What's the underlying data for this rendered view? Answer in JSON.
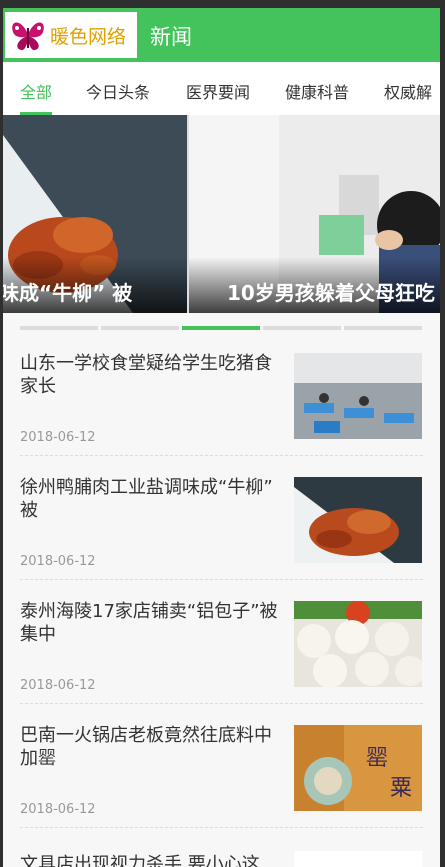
{
  "header": {
    "logo_text": "暖色网络",
    "title": "新闻"
  },
  "tabs": [
    {
      "label": "全部",
      "active": true
    },
    {
      "label": "今日头条",
      "active": false
    },
    {
      "label": "医界要闻",
      "active": false
    },
    {
      "label": "健康科普",
      "active": false
    },
    {
      "label": "权威解",
      "active": false
    }
  ],
  "carousel": {
    "slides": [
      {
        "caption": "味成“牛柳” 被"
      },
      {
        "caption": "10岁男孩躲着父母狂吃"
      }
    ],
    "indicator_count": 5,
    "active_index": 2
  },
  "news": [
    {
      "title": "山东一学校食堂疑给学生吃猪食家长",
      "date": "2018-06-12",
      "thumb": "cafeteria-photo"
    },
    {
      "title": "徐州鸭脯肉工业盐调味成“牛柳” 被",
      "date": "2018-06-12",
      "thumb": "braised-meat-photo"
    },
    {
      "title": "泰州海陵17家店铺卖“铝包子”被集中",
      "date": "2018-06-12",
      "thumb": "steamed-buns-photo"
    },
    {
      "title": "巴南一火锅店老板竟然往底料中加罂",
      "date": "2018-06-12",
      "thumb": "poppy-seed-photo"
    }
  ],
  "partial_item": {
    "title": "文具店出现视力杀手 要小心这"
  },
  "colors": {
    "accent": "#44c25c",
    "text": "#333333",
    "muted": "#999999"
  }
}
